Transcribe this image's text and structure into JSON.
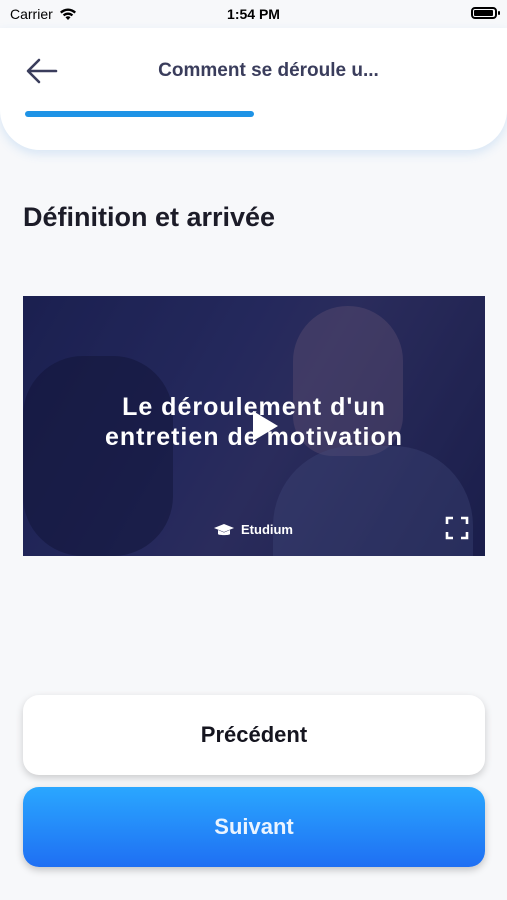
{
  "status_bar": {
    "carrier": "Carrier",
    "time": "1:54 PM"
  },
  "header": {
    "title": "Comment se déroule u...",
    "progress": 0.5
  },
  "section": {
    "title": "Définition et arrivée"
  },
  "video": {
    "title_line1": "Le déroulement d'un",
    "title_line2": "entretien de motivation",
    "brand": "Etudium"
  },
  "buttons": {
    "previous_label": "Précédent",
    "next_label": "Suivant"
  },
  "colors": {
    "accent": "#1e93e6",
    "next_gradient_top": "#2aa7ff",
    "next_gradient_bottom": "#1f6ff3"
  }
}
